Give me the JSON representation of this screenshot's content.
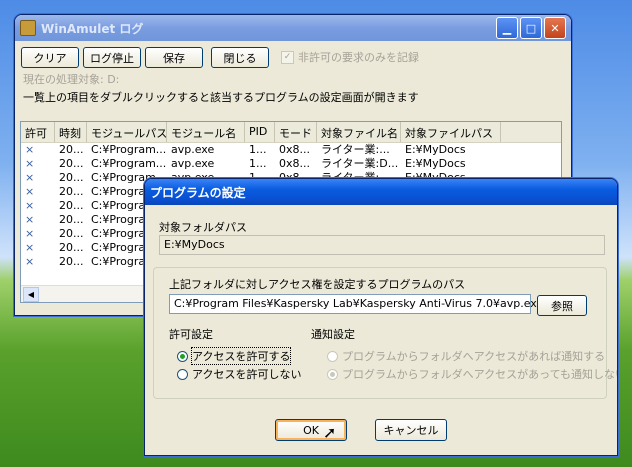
{
  "main_window": {
    "title": "WinAmulet ログ",
    "toolbar": {
      "clear": "クリア",
      "stop": "ログ停止",
      "save": "保存",
      "close": "閉じる",
      "checkbox_label": "非許可の要求のみを記録"
    },
    "current_target": "現在の処理対象: D:",
    "instruction": "一覧上の項目をダブルクリックすると該当するプログラムの設定画面が開きます",
    "columns": [
      "許可",
      "時刻",
      "モジュールパス",
      "モジュール名",
      "PID",
      "モード",
      "対象ファイル名",
      "対象ファイルパス"
    ],
    "rows": [
      [
        "×",
        "20...",
        "C:¥Program...",
        "avp.exe",
        "1...",
        "0x8...",
        "ライター業:...",
        "E:¥MyDocs"
      ],
      [
        "×",
        "20...",
        "C:¥Program...",
        "avp.exe",
        "1...",
        "0x8...",
        "ライター業:D...",
        "E:¥MyDocs"
      ],
      [
        "×",
        "20...",
        "C:¥Program...",
        "avp.exe",
        "1...",
        "0x8...",
        "ライター業:...",
        "E:¥MyDocs"
      ],
      [
        "×",
        "20...",
        "C:¥Program...",
        "avp.exe",
        "1...",
        "0x8...",
        "ライター業:...",
        "E:¥MyDocs"
      ],
      [
        "×",
        "20...",
        "C:¥Program...",
        "",
        "",
        "",
        "",
        ""
      ],
      [
        "×",
        "20...",
        "C:¥Program...",
        "",
        "",
        "",
        "",
        ""
      ],
      [
        "×",
        "20...",
        "C:¥Program...",
        "",
        "",
        "",
        "",
        ""
      ],
      [
        "×",
        "20...",
        "C:¥Program...",
        "",
        "",
        "",
        "",
        ""
      ],
      [
        "×",
        "20...",
        "C:¥Program...",
        "",
        "",
        "",
        "",
        ""
      ]
    ]
  },
  "dialog": {
    "title": "プログラムの設定",
    "folder_label": "対象フォルダパス",
    "folder_value": "E:¥MyDocs",
    "program_label": "上記フォルダに対しアクセス権を設定するプログラムのパス",
    "program_value": "C:¥Program Files¥Kaspersky Lab¥Kaspersky Anti-Virus 7.0¥avp.exe",
    "browse": "参照",
    "permission_heading": "許可設定",
    "allow": "アクセスを許可する",
    "deny": "アクセスを許可しない",
    "notify_heading": "通知設定",
    "notify_on": "プログラムからフォルダへアクセスがあれば通知する",
    "notify_off": "プログラムからフォルダへアクセスがあっても通知しない",
    "ok": "OK",
    "cancel": "キャンセル"
  }
}
